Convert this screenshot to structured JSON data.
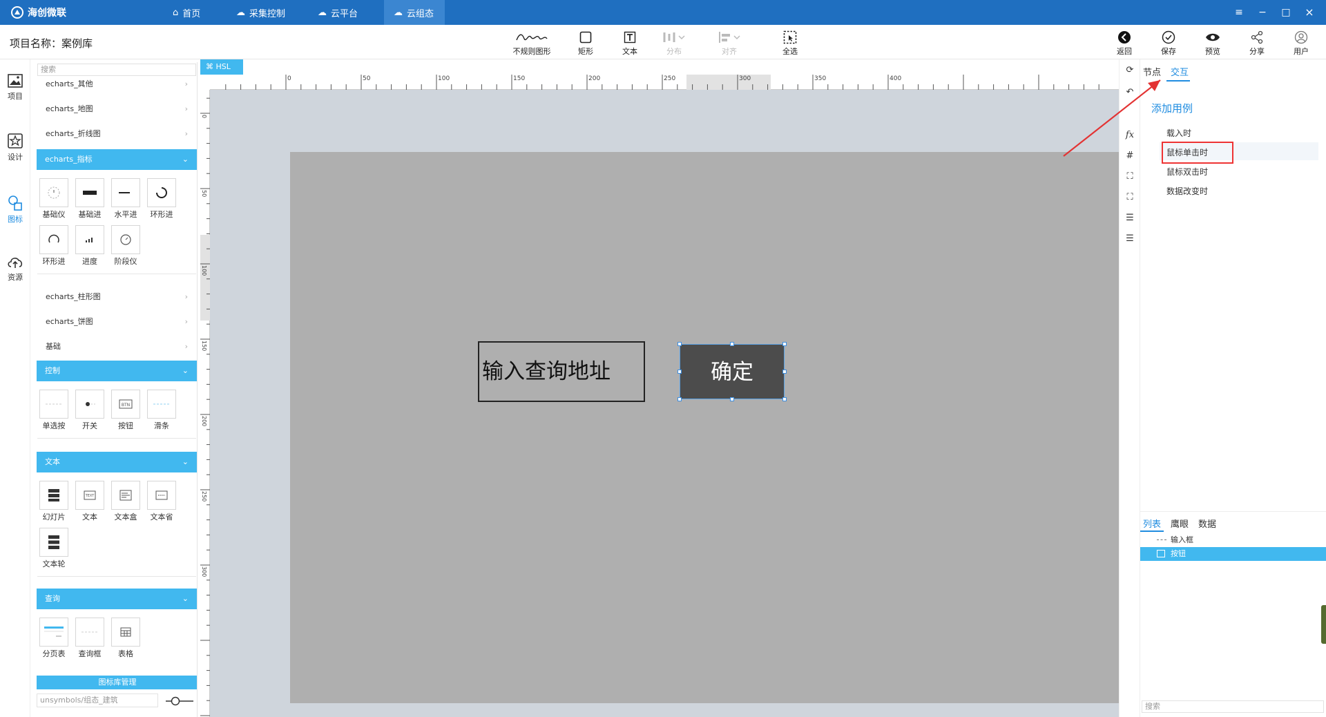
{
  "app": {
    "name": "海创微联"
  },
  "nav": {
    "tabs": [
      {
        "label": "首页",
        "icon": "home-icon"
      },
      {
        "label": "采集控制",
        "icon": "cloud-control-icon"
      },
      {
        "label": "云平台",
        "icon": "cloud-platform-icon"
      },
      {
        "label": "云组态",
        "icon": "cloud-config-icon"
      }
    ],
    "active": "云组态"
  },
  "window": {
    "minimize": "−",
    "maximize": "□",
    "close": "×",
    "menu": "≡"
  },
  "project": {
    "label": "项目名称：案例库"
  },
  "toolbar": {
    "irregular": "不规则图形",
    "rect": "矩形",
    "text": "文本",
    "distribute": "分布",
    "align": "对齐",
    "select_all": "全选",
    "back": "返回",
    "save": "保存",
    "preview": "预览",
    "share": "分享",
    "user": "用户"
  },
  "leftnav": {
    "items": [
      {
        "label": "项目",
        "icon": "image-icon"
      },
      {
        "label": "设计",
        "icon": "design-star-icon"
      },
      {
        "label": "图标",
        "icon": "shapes-icon"
      },
      {
        "label": "资源",
        "icon": "cloud-upload-icon"
      }
    ],
    "active": "图标"
  },
  "panel": {
    "search_placeholder": "搜索",
    "groups_top": [
      "echarts_其他",
      "echarts_地图",
      "echarts_折线图"
    ],
    "group_indicator": "echarts_指标",
    "indicator_tiles": [
      "基础仪",
      "基础进",
      "水平进",
      "环形进",
      "环形进",
      "进度",
      "阶段仪"
    ],
    "groups_mid": [
      "echarts_柱形图",
      "echarts_饼图",
      "基础"
    ],
    "group_control": "控制",
    "control_tiles": [
      "单选按",
      "开关",
      "按钮",
      "滑条"
    ],
    "group_text": "文本",
    "text_tiles": [
      "幻灯片",
      "文本",
      "文本盒",
      "文本省",
      "文本轮"
    ],
    "group_query": "查询",
    "query_tiles": [
      "分页表",
      "查询框",
      "表格"
    ],
    "lib_manager": "图标库管理",
    "lib_path": "unsymbols/组态_建筑"
  },
  "canvas": {
    "tab_label": "HSL",
    "ruler_top": [
      "0",
      "50",
      "100",
      "150",
      "200",
      "250",
      "300",
      "350",
      "400"
    ],
    "ruler_left": [
      "0",
      "50",
      "100",
      "150",
      "200",
      "250",
      "300"
    ],
    "input_text": "输入查询地址",
    "button_text": "确定"
  },
  "right": {
    "tabs": [
      "节点",
      "交互"
    ],
    "active_tab": "交互",
    "add_case": "添加用例",
    "events": [
      "载入时",
      "鼠标单击时",
      "鼠标双击时",
      "数据改变时"
    ],
    "highlighted_event": "鼠标单击时",
    "bottom_tabs": [
      "列表",
      "鹰眼",
      "数据"
    ],
    "active_bottom_tab": "列表",
    "layers": [
      "输入框",
      "按钮"
    ],
    "selected_layer": "按钮",
    "search_placeholder": "搜索"
  },
  "colors": {
    "topbar": "#1f6fc0",
    "accent": "#41b8ef",
    "link": "#1f8ce0",
    "stage": "#afafaf",
    "button": "#4c4c4c",
    "annotation": "#e33333"
  }
}
